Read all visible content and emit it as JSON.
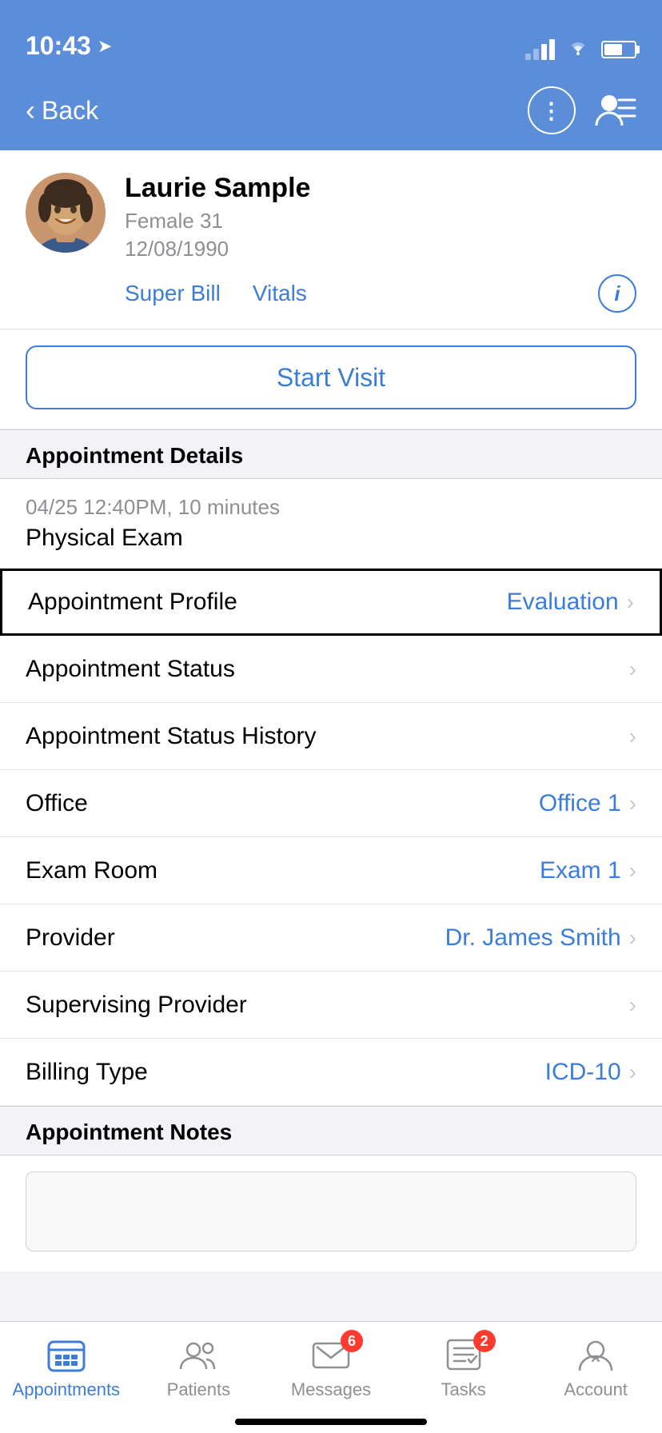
{
  "statusBar": {
    "time": "10:43",
    "locationIcon": "▷"
  },
  "navBar": {
    "backLabel": "Back",
    "moreIcon": "⋮",
    "listIcon": "≡"
  },
  "patient": {
    "name": "Laurie Sample",
    "gender": "Female",
    "age": "31",
    "dob": "12/08/1990",
    "superBillLabel": "Super Bill",
    "vitalsLabel": "Vitals",
    "infoIcon": "i"
  },
  "startVisit": {
    "label": "Start Visit"
  },
  "appointmentDetails": {
    "sectionTitle": "Appointment Details",
    "datetime": "04/25 12:40PM, 10 minutes",
    "type": "Physical Exam"
  },
  "listItems": [
    {
      "label": "Appointment Profile",
      "value": "Evaluation",
      "hasValue": true,
      "highlighted": true
    },
    {
      "label": "Appointment Status",
      "value": "",
      "hasValue": false,
      "highlighted": false
    },
    {
      "label": "Appointment Status History",
      "value": "",
      "hasValue": false,
      "highlighted": false
    },
    {
      "label": "Office",
      "value": "Office 1",
      "hasValue": true,
      "highlighted": false
    },
    {
      "label": "Exam Room",
      "value": "Exam 1",
      "hasValue": true,
      "highlighted": false
    },
    {
      "label": "Provider",
      "value": "Dr. James Smith",
      "hasValue": true,
      "highlighted": false
    },
    {
      "label": "Supervising Provider",
      "value": "",
      "hasValue": false,
      "highlighted": false
    },
    {
      "label": "Billing Type",
      "value": "ICD-10",
      "hasValue": true,
      "highlighted": false
    }
  ],
  "appointmentNotes": {
    "sectionTitle": "Appointment Notes",
    "placeholder": ""
  },
  "tabBar": {
    "tabs": [
      {
        "label": "Appointments",
        "icon": "grid",
        "active": true,
        "badge": 0
      },
      {
        "label": "Patients",
        "icon": "people",
        "active": false,
        "badge": 0
      },
      {
        "label": "Messages",
        "icon": "envelope",
        "active": false,
        "badge": 6
      },
      {
        "label": "Tasks",
        "icon": "checklist",
        "active": false,
        "badge": 2
      },
      {
        "label": "Account",
        "icon": "person",
        "active": false,
        "badge": 0
      }
    ]
  },
  "colors": {
    "accent": "#3b7dd8",
    "headerBg": "#5b8dd9",
    "textPrimary": "#000000",
    "textSecondary": "#8e8e93",
    "separator": "#e5e5ea",
    "sectionBg": "#f2f2f7",
    "badgeRed": "#ff3b30"
  }
}
